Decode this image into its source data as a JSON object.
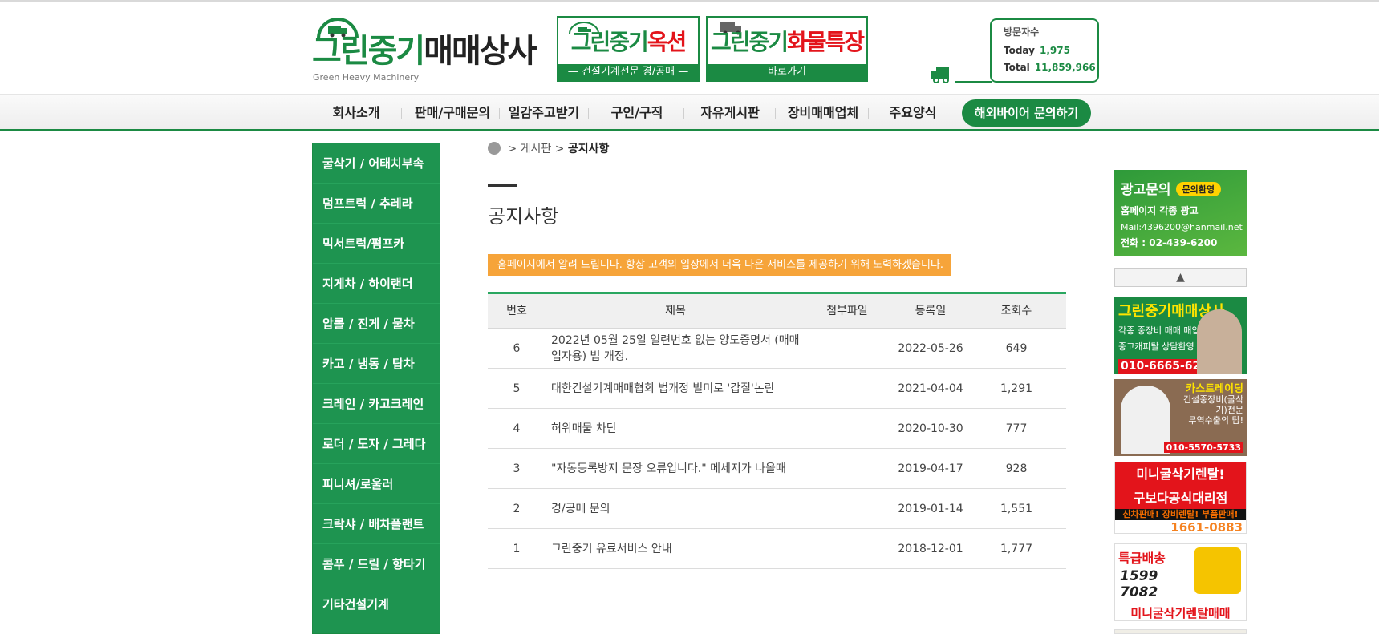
{
  "header": {
    "logo_main_green": "그린중기",
    "logo_main_dark": "매매상사",
    "logo_sub": "Green Heavy Machinery",
    "banner_auction": {
      "green": "그린중기",
      "red": "옥션",
      "bottom": "— 건설기계전문 경/공매 —"
    },
    "banner_cargo": {
      "green": "그린중기",
      "red": "화물특장",
      "bottom": "바로가기"
    },
    "visitors": {
      "title": "방문자수",
      "today_label": "Today",
      "today_value": "1,975",
      "total_label": "Total",
      "total_value": "11,859,966"
    }
  },
  "nav": {
    "items": [
      "회사소개",
      "판매/구매문의",
      "일감주고받기",
      "구인/구직",
      "자유게시판",
      "장비매매업체",
      "주요양식"
    ],
    "overseas_button": "해외바이어 문의하기"
  },
  "sidebar": {
    "items": [
      "굴삭기 / 어태치부속",
      "덤프트럭 / 추레라",
      "믹서트럭/펌프카",
      "지게차 / 하이랜더",
      "압롤 / 진게 / 물차",
      "카고 / 냉동 / 탑차",
      "크레인 / 카고크레인",
      "로더 / 도자 / 그레다",
      "피니셔/로울러",
      "크락샤 / 배차플랜트",
      "콤푸 / 드릴 / 항타기",
      "기타건설기계"
    ]
  },
  "breadcrumb": {
    "sep": ">",
    "board": "게시판",
    "current": "공지사항"
  },
  "page_title": "공지사항",
  "notice_text": "홈페이지에서 알려 드립니다. 항상 고객의 입장에서 더욱 나은 서비스를 제공하기 위해 노력하겠습니다.",
  "table": {
    "headers": {
      "num": "번호",
      "title": "제목",
      "file": "첨부파일",
      "date": "등록일",
      "hits": "조회수"
    },
    "rows": [
      {
        "num": "6",
        "title": "2022년 05월 25일 일련번호 없는 양도증명서 (매매업자용) 법 개정.",
        "date": "2022-05-26",
        "hits": "649"
      },
      {
        "num": "5",
        "title": "대한건설기계매매협회 법개정 빌미로 '갑질'논란",
        "date": "2021-04-04",
        "hits": "1,291"
      },
      {
        "num": "4",
        "title": "허위매물 차단",
        "date": "2020-10-30",
        "hits": "777"
      },
      {
        "num": "3",
        "title": "\"자동등록방지 문장 오류입니다.\" 메세지가 나올때",
        "date": "2019-04-17",
        "hits": "928"
      },
      {
        "num": "2",
        "title": "경/공매 문의",
        "date": "2019-01-14",
        "hits": "1,551"
      },
      {
        "num": "1",
        "title": "그린중기 유료서비스 안내",
        "date": "2018-12-01",
        "hits": "1,777"
      }
    ]
  },
  "ads": {
    "ad1": {
      "title": "광고문의",
      "pill": "문의환영",
      "line1": "홈페이지 각종 광고",
      "line2": "Mail:4396200@hanmail.net",
      "line3": "전화 : 02-439-6200"
    },
    "scroll_up": "▲",
    "ad2": {
      "title": "그린중기매매상사",
      "line1": "각종 중장비 매매 매입",
      "line2": "중고캐피탈 상담환영",
      "phone": "010-6665-6200"
    },
    "ad3": {
      "title": "카스트레이딩",
      "line1": "건설중장비(굴삭기)전문",
      "line2": "무역수출의 탑!",
      "phone": "010-5570-5733"
    },
    "ad4": {
      "line1": "미니굴삭기렌탈!",
      "line2": "구보다공식대리점",
      "line3": "신차판매! 장비렌탈! 부품판매!",
      "phone": "1661-0883"
    },
    "ad5": {
      "title": "특급배송",
      "num1": "1599",
      "num2": "7082",
      "bottom": "미니굴삭기렌탈매매"
    }
  }
}
